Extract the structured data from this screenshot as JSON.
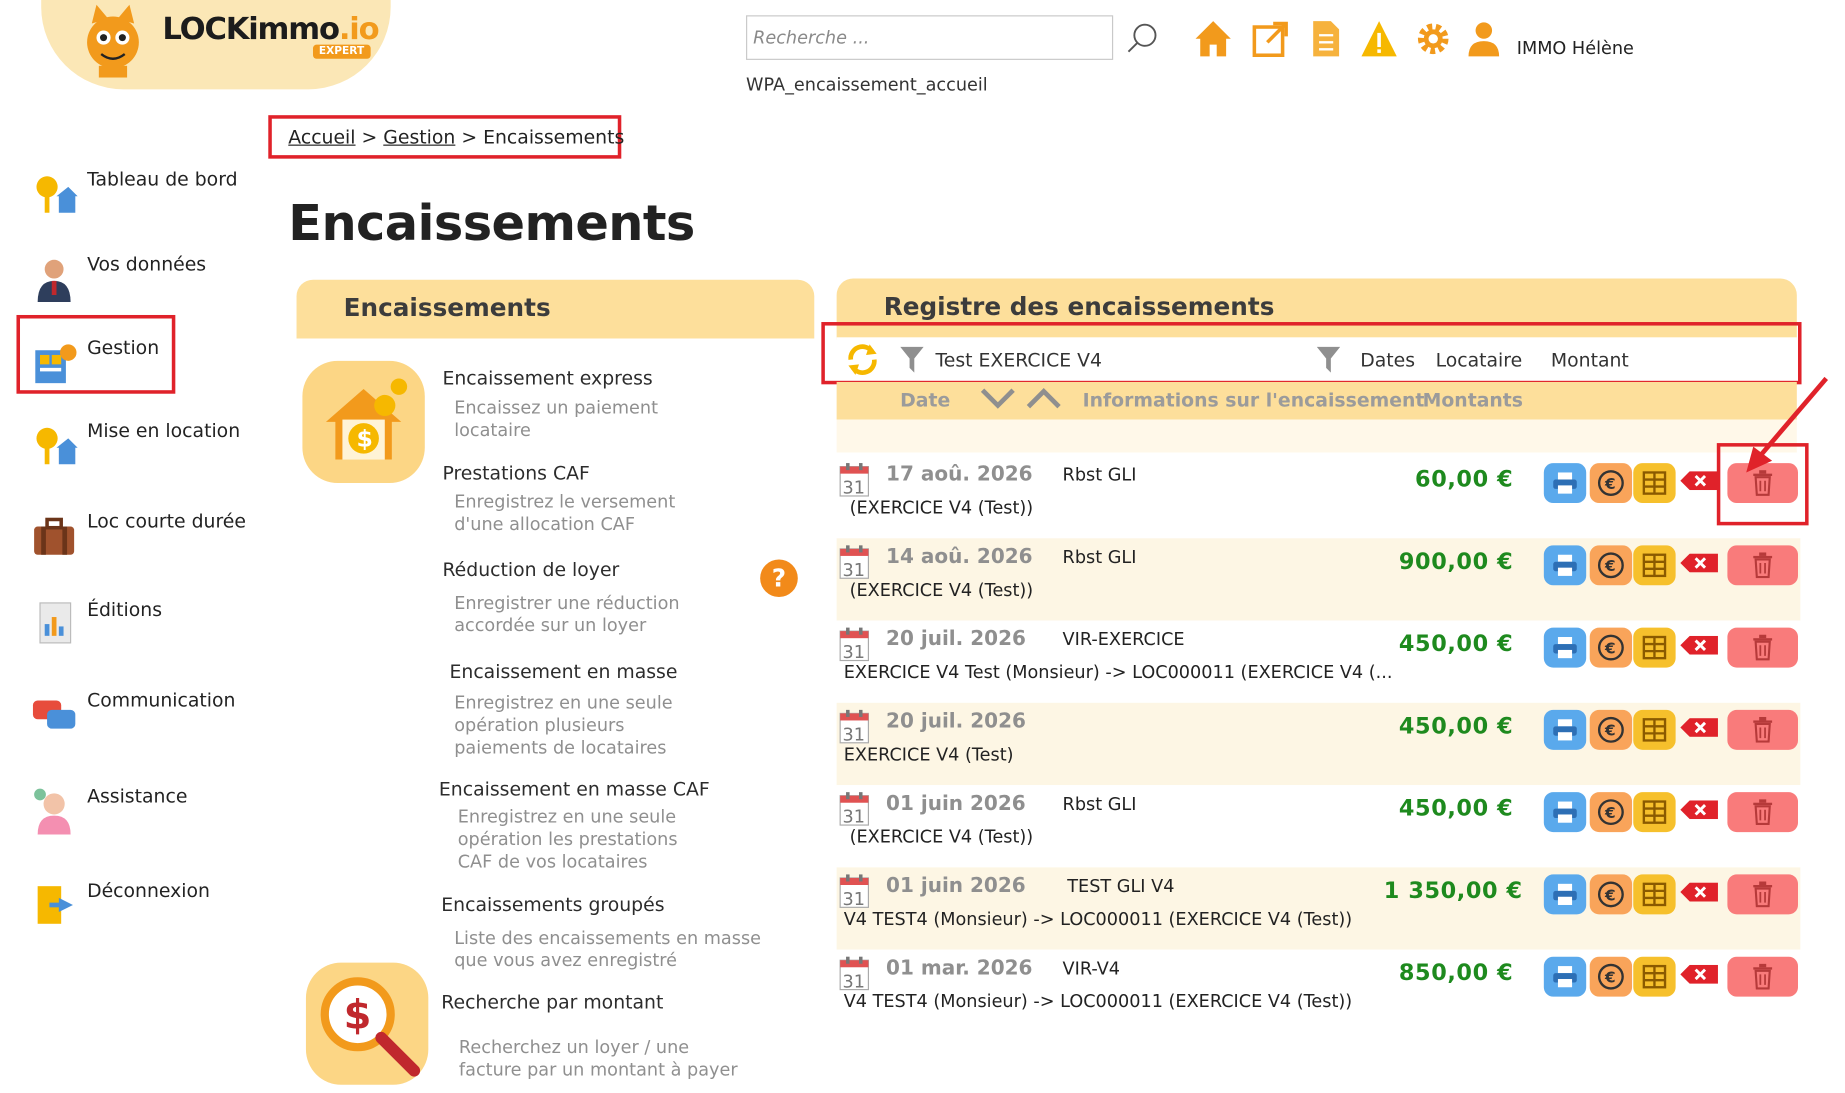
{
  "header": {
    "logo_text": "LOCKimmo",
    "logo_suffix": ".io",
    "logo_badge": "EXPERT",
    "search_placeholder": "Recherche ...",
    "page_id": "WPA_encaissement_accueil",
    "user_name": "IMMO Hélène",
    "icons": [
      "home-icon",
      "external-link-icon",
      "document-icon",
      "warning-icon",
      "gear-icon",
      "user-icon"
    ]
  },
  "sidebar": {
    "items": [
      {
        "label": "Tableau de bord",
        "icon": "dashboard-icon"
      },
      {
        "label": "Vos données",
        "icon": "profile-icon"
      },
      {
        "label": "Gestion",
        "icon": "management-icon"
      },
      {
        "label": "Mise en location",
        "icon": "rental-icon"
      },
      {
        "label": "Loc courte durée",
        "icon": "suitcase-icon"
      },
      {
        "label": "Éditions",
        "icon": "report-icon"
      },
      {
        "label": "Communication",
        "icon": "chat-icon"
      },
      {
        "label": "Assistance",
        "icon": "support-icon"
      },
      {
        "label": "Déconnexion",
        "icon": "logout-icon"
      }
    ]
  },
  "breadcrumb": {
    "home": "Accueil",
    "sep": ">",
    "section": "Gestion",
    "current": "Encaissements"
  },
  "page_title": "Encaissements",
  "left_panel": {
    "title": "Encaissements",
    "items": [
      {
        "title": "Encaissement express",
        "desc1": "Encaissez un paiement",
        "desc2": "locataire",
        "desc3": ""
      },
      {
        "title": "Prestations CAF",
        "desc1": "Enregistrez le versement",
        "desc2": "d'une allocation CAF",
        "desc3": ""
      },
      {
        "title": "Réduction de loyer",
        "desc1": "Enregistrer une réduction",
        "desc2": "accordée sur un loyer",
        "desc3": ""
      },
      {
        "title": "Encaissement en masse",
        "desc1": "Enregistrez en une seule",
        "desc2": "opération plusieurs",
        "desc3": "paiements de locataires"
      },
      {
        "title": "Encaissement en masse CAF",
        "desc1": "Enregistrez en une seule",
        "desc2": "opération les prestations",
        "desc3": "CAF de vos locataires"
      },
      {
        "title": "Encaissements groupés",
        "desc1": "Liste des encaissements en masse",
        "desc2": "que vous avez enregistré",
        "desc3": ""
      },
      {
        "title": "Recherche par montant",
        "desc1": "Recherchez un loyer / une",
        "desc2": "facture par un montant à payer",
        "desc3": ""
      }
    ],
    "help": "?"
  },
  "right_panel": {
    "title": "Registre des encaissements",
    "filter_value": "Test EXERCICE V4",
    "filters": [
      "Dates",
      "Locataire",
      "Montant"
    ],
    "sort_cols": {
      "date": "Date",
      "info": "Informations sur l'encaissement",
      "amounts": "Montants"
    },
    "calendar_day": "31",
    "rows": [
      {
        "date": "17 aoû. 2026",
        "label": "Rbst GLI",
        "info": "(EXERCICE V4 (Test))",
        "amount": "60,00 €"
      },
      {
        "date": "14 aoû. 2026",
        "label": "Rbst GLI",
        "info": "(EXERCICE V4 (Test))",
        "amount": "900,00 €"
      },
      {
        "date": "20 juil. 2026",
        "label": "VIR-EXERCICE",
        "info": "EXERCICE V4 Test (Monsieur) -> LOC000011 (EXERCICE V4 (...",
        "amount": "450,00 €"
      },
      {
        "date": "20 juil. 2026",
        "label": "",
        "info": "EXERCICE V4 (Test)",
        "amount": "450,00 €"
      },
      {
        "date": "01 juin 2026",
        "label": "Rbst GLI",
        "info": "(EXERCICE V4 (Test))",
        "amount": "450,00 €"
      },
      {
        "date": "01 juin 2026",
        "label": "TEST GLI V4",
        "info": "V4 TEST4 (Monsieur) -> LOC000011 (EXERCICE V4 (Test))",
        "amount": "1 350,00 €"
      },
      {
        "date": "01 mar. 2026",
        "label": "VIR-V4",
        "info": "V4 TEST4 (Monsieur) -> LOC000011 (EXERCICE V4 (Test))",
        "amount": "850,00 €"
      }
    ]
  },
  "colors": {
    "accent": "#fddf9b",
    "highlight": "#e0222a",
    "amount": "#1e8a1e",
    "orange": "#f29a1c"
  }
}
